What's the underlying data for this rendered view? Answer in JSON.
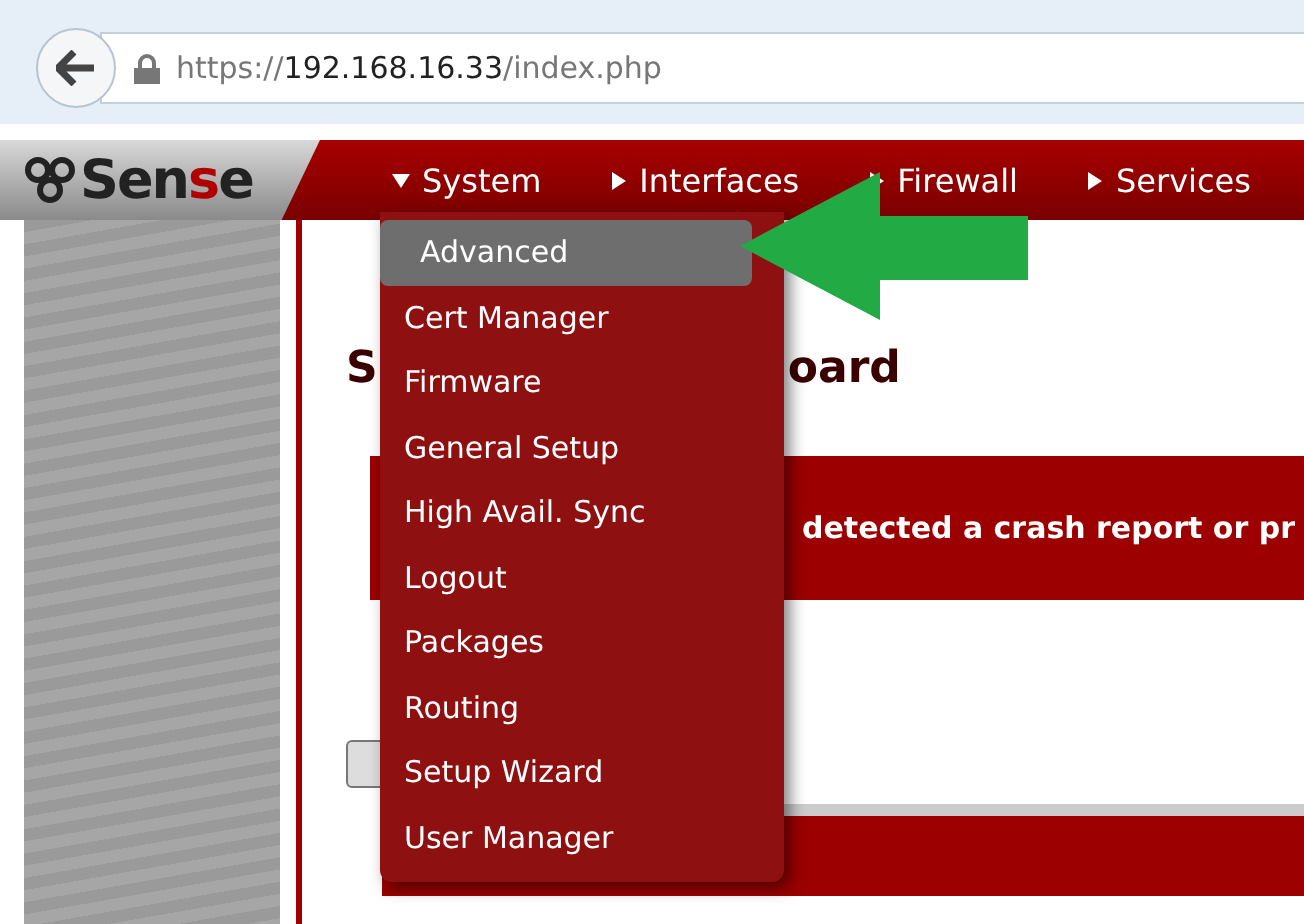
{
  "browser": {
    "url_scheme": "https://",
    "url_host": "192.168.16.33",
    "url_path": "/index.php"
  },
  "logo": {
    "parts": [
      {
        "text": "Sen",
        "accent": false
      },
      {
        "text": "s",
        "accent": true
      },
      {
        "text": "e",
        "accent": false
      }
    ]
  },
  "nav": [
    {
      "label": "System",
      "expanded": true
    },
    {
      "label": "Interfaces",
      "expanded": false
    },
    {
      "label": "Firewall",
      "expanded": false
    },
    {
      "label": "Services",
      "expanded": false
    }
  ],
  "system_menu": [
    {
      "label": "Advanced",
      "selected": true
    },
    {
      "label": "Cert Manager",
      "selected": false
    },
    {
      "label": "Firmware",
      "selected": false
    },
    {
      "label": "General Setup",
      "selected": false
    },
    {
      "label": "High Avail. Sync",
      "selected": false
    },
    {
      "label": "Logout",
      "selected": false
    },
    {
      "label": "Packages",
      "selected": false
    },
    {
      "label": "Routing",
      "selected": false
    },
    {
      "label": "Setup Wizard",
      "selected": false
    },
    {
      "label": "User Manager",
      "selected": false
    }
  ],
  "page_title": {
    "start": "S",
    "end": "oard"
  },
  "notice": "detected a crash report or pr"
}
